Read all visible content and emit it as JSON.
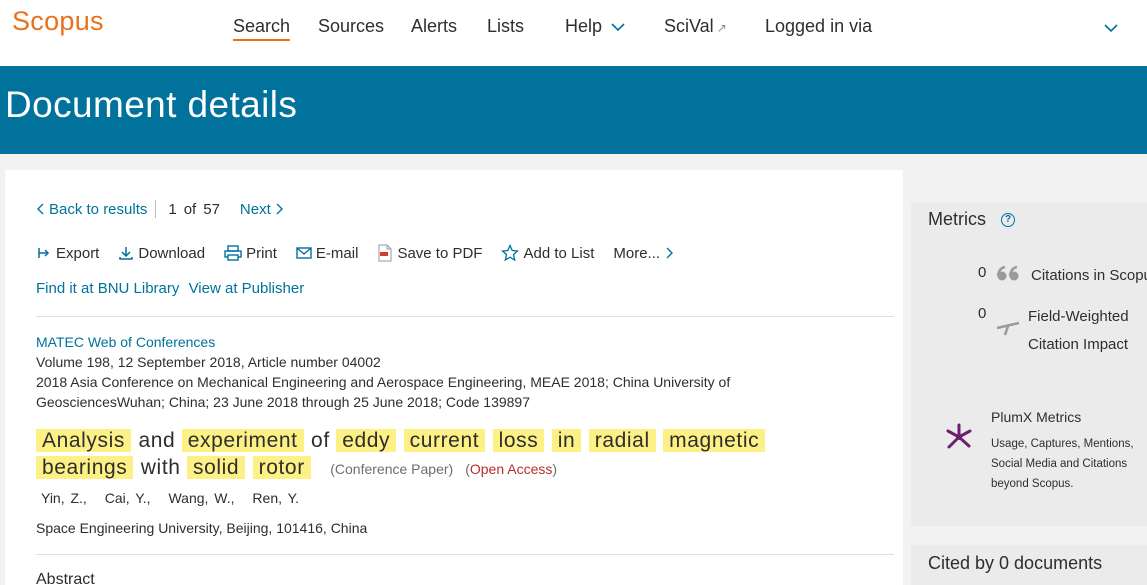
{
  "brand": {
    "logo": "Scopus",
    "accent_color": "#e9711c",
    "link_color": "#00729c",
    "banner_color": "#00729c"
  },
  "nav": {
    "search": "Search",
    "sources": "Sources",
    "alerts": "Alerts",
    "lists": "Lists",
    "help": "Help",
    "scival": "SciVal",
    "logged_in": "Logged in via"
  },
  "page_title": "Document details",
  "result_nav": {
    "back": "Back to results",
    "position": "1",
    "of": "of",
    "total": "57",
    "next": "Next"
  },
  "tools": {
    "export": "Export",
    "download": "Download",
    "print": "Print",
    "email": "E-mail",
    "save_pdf": "Save to PDF",
    "add_list": "Add to List",
    "more": "More..."
  },
  "links": {
    "find_it": "Find it at BNU Library",
    "view_publisher": "View at Publisher"
  },
  "document": {
    "journal": "MATEC Web of Conferences",
    "volume": "Volume 198, 12 September 2018, Article number 04002",
    "conference_line1": "2018 Asia Conference on Mechanical Engineering and Aerospace Engineering, MEAE 2018; China University of",
    "conference_line2": "GeosciencesWuhan; China; 23 June 2018 through 25 June 2018; Code 139897",
    "title_words": [
      "Analysis",
      "and",
      "experiment",
      "of",
      "eddy",
      "current",
      "loss",
      "in",
      "radial",
      "magnetic",
      "bearings",
      "with",
      "solid",
      "rotor"
    ],
    "doc_type": "(Conference Paper)",
    "open_access": "Open Access",
    "authors": [
      "Yin, Z.,",
      "Cai, Y.,",
      "Wang, W.,",
      "Ren, Y."
    ],
    "affiliation": "Space Engineering University, Beijing, 101416, China",
    "abstract_heading": "Abstract"
  },
  "metrics": {
    "heading": "Metrics",
    "help_icon": "?",
    "citations_count": "0",
    "citations_label": "Citations in Scopus",
    "fwci_value": "0",
    "fwci_line1": "Field-Weighted",
    "fwci_line2": "Citation Impact",
    "plumx_title": "PlumX Metrics",
    "plumx_desc": "Usage, Captures, Mentions, Social Media and Citations beyond Scopus."
  },
  "cited_by": "Cited by 0 documents"
}
